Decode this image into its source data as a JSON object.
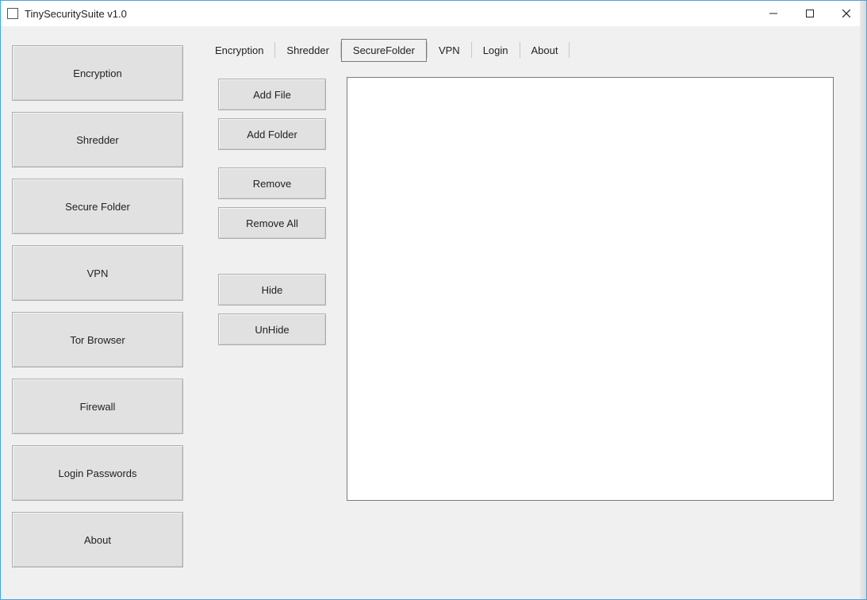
{
  "window": {
    "title": "TinySecuritySuite v1.0"
  },
  "sidebar": {
    "items": [
      {
        "label": "Encryption"
      },
      {
        "label": "Shredder"
      },
      {
        "label": "Secure Folder"
      },
      {
        "label": "VPN"
      },
      {
        "label": "Tor Browser"
      },
      {
        "label": "Firewall"
      },
      {
        "label": "Login Passwords"
      },
      {
        "label": "About"
      }
    ]
  },
  "tabs": {
    "items": [
      {
        "label": "Encryption",
        "active": false
      },
      {
        "label": "Shredder",
        "active": false
      },
      {
        "label": "SecureFolder",
        "active": true
      },
      {
        "label": "VPN",
        "active": false
      },
      {
        "label": "Login",
        "active": false
      },
      {
        "label": "About",
        "active": false
      }
    ]
  },
  "secure_folder": {
    "buttons": {
      "add_file": "Add File",
      "add_folder": "Add Folder",
      "remove": "Remove",
      "remove_all": "Remove All",
      "hide": "Hide",
      "unhide": "UnHide"
    },
    "list_items": []
  }
}
